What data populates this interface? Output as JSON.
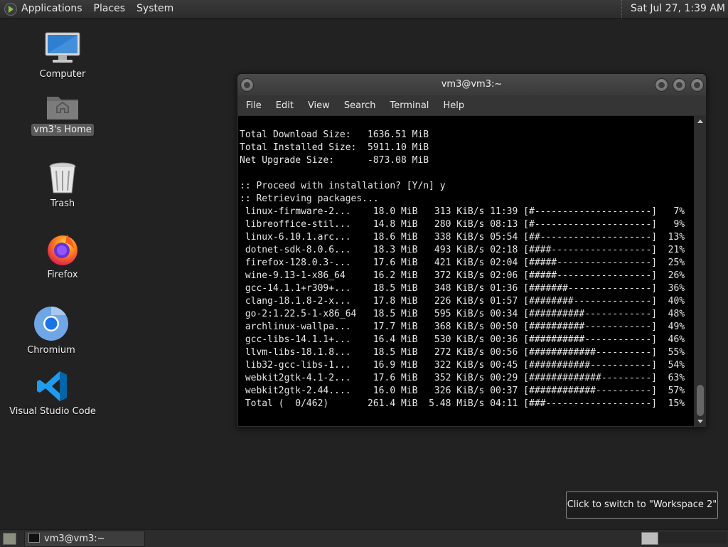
{
  "top_panel": {
    "menus": [
      "Applications",
      "Places",
      "System"
    ],
    "clock": "Sat Jul 27, 1:39 AM"
  },
  "desktop_icons": [
    {
      "label": "Computer",
      "icon": "computer-icon"
    },
    {
      "label": "vm3's Home",
      "icon": "home-folder-icon",
      "selected": true
    },
    {
      "label": "Trash",
      "icon": "trash-icon"
    },
    {
      "label": "Firefox",
      "icon": "firefox-icon"
    },
    {
      "label": "Chromium",
      "icon": "chromium-icon"
    },
    {
      "label": "Visual Studio Code",
      "icon": "vscode-icon"
    }
  ],
  "window": {
    "title": "vm3@vm3:~",
    "menu": [
      "File",
      "Edit",
      "View",
      "Search",
      "Terminal",
      "Help"
    ],
    "terminal_lines": [
      "Total Download Size:   1636.51 MiB",
      "Total Installed Size:  5911.10 MiB",
      "Net Upgrade Size:      -873.08 MiB",
      "",
      ":: Proceed with installation? [Y/n] y",
      ":: Retrieving packages...",
      " linux-firmware-2...    18.0 MiB   313 KiB/s 11:39 [#---------------------]   7%",
      " libreoffice-stil...    14.8 MiB   280 KiB/s 08:13 [#---------------------]   9%",
      " linux-6.10.1.arc...    18.6 MiB   338 KiB/s 05:54 [##--------------------]  13%",
      " dotnet-sdk-8.0.6...    18.3 MiB   493 KiB/s 02:18 [####------------------]  21%",
      " firefox-128.0.3-...    17.6 MiB   421 KiB/s 02:04 [#####-----------------]  25%",
      " wine-9.13-1-x86_64     16.2 MiB   372 KiB/s 02:06 [#####-----------------]  26%",
      " gcc-14.1.1+r309+...    18.5 MiB   348 KiB/s 01:36 [#######---------------]  36%",
      " clang-18.1.8-2-x...    17.8 MiB   226 KiB/s 01:57 [########--------------]  40%",
      " go-2:1.22.5-1-x86_64   18.5 MiB   595 KiB/s 00:34 [##########------------]  48%",
      " archlinux-wallpa...    17.7 MiB   368 KiB/s 00:50 [##########------------]  49%",
      " gcc-libs-14.1.1+...    16.4 MiB   530 KiB/s 00:36 [##########------------]  46%",
      " llvm-libs-18.1.8...    18.5 MiB   272 KiB/s 00:56 [############----------]  55%",
      " lib32-gcc-libs-1...    16.9 MiB   322 KiB/s 00:45 [###########-----------]  54%",
      " webkit2gtk-4.1-2...    17.6 MiB   352 KiB/s 00:29 [#############---------]  63%",
      " webkit2gtk-2.44....    16.0 MiB   326 KiB/s 00:37 [############----------]  57%",
      " Total (  0/462)       261.4 MiB  5.48 MiB/s 04:11 [###-------------------]  15%"
    ]
  },
  "tooltip": "Click to switch to \"Workspace 2\"",
  "bottom_panel": {
    "task_label": "vm3@vm3:~"
  }
}
